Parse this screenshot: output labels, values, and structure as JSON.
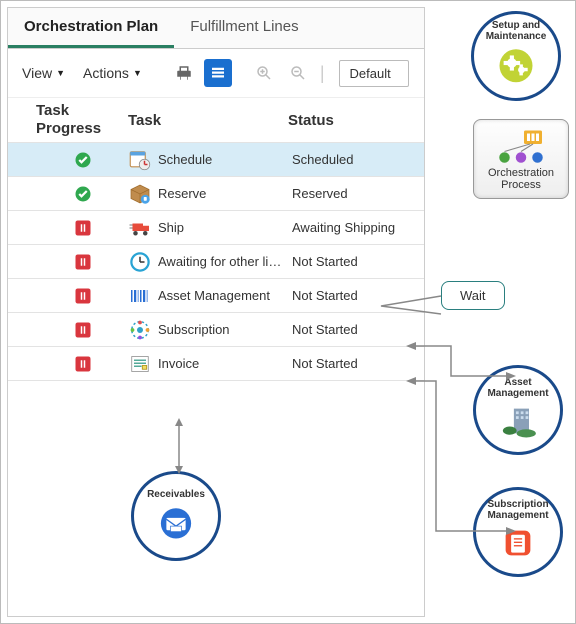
{
  "tabs": [
    {
      "label": "Orchestration Plan",
      "active": true
    },
    {
      "label": "Fulfillment Lines",
      "active": false
    }
  ],
  "toolbar": {
    "view_label": "View",
    "actions_label": "Actions",
    "dropdown_value": "Default"
  },
  "table": {
    "headers": {
      "progress": "Task Progress",
      "task": "Task",
      "status": "Status"
    },
    "rows": [
      {
        "progress": "check",
        "icon": "schedule-icon",
        "task": "Schedule",
        "status": "Scheduled",
        "selected": true
      },
      {
        "progress": "check",
        "icon": "reserve-icon",
        "task": "Reserve",
        "status": "Reserved"
      },
      {
        "progress": "pause",
        "icon": "ship-icon",
        "task": "Ship",
        "status": "Awaiting Shipping"
      },
      {
        "progress": "pause",
        "icon": "clock-icon",
        "task": "Awaiting for other lines",
        "status": "Not Started"
      },
      {
        "progress": "pause",
        "icon": "barcode-icon",
        "task": "Asset Management",
        "status": "Not Started"
      },
      {
        "progress": "pause",
        "icon": "subscription-icon",
        "task": "Subscription",
        "status": "Not Started"
      },
      {
        "progress": "pause",
        "icon": "invoice-icon",
        "task": "Invoice",
        "status": "Not Started"
      }
    ]
  },
  "callouts": {
    "wait": "Wait",
    "setup": "Setup and Maintenance",
    "orchestration": "Orchestration Process",
    "receivables": "Receivables",
    "asset": "Asset Management",
    "subscription": "Subscription Management"
  }
}
